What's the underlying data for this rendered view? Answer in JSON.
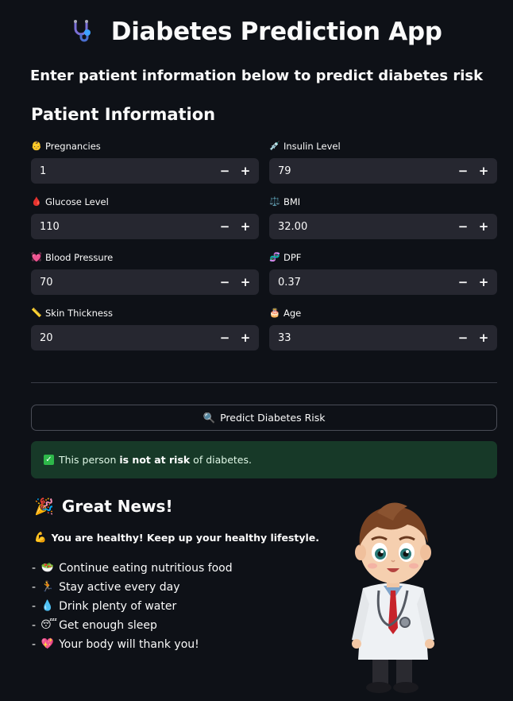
{
  "header": {
    "title_icon": "stethoscope-icon",
    "title": "Diabetes Prediction App",
    "subtitle": "Enter patient information below to predict diabetes risk"
  },
  "form": {
    "section_title": "Patient Information",
    "fields": [
      {
        "label": "Pregnancies",
        "icon": "baby-icon",
        "value": "1"
      },
      {
        "label": "Insulin Level",
        "icon": "syringe-icon",
        "value": "79"
      },
      {
        "label": "Glucose Level",
        "icon": "blood-drop-icon",
        "value": "110"
      },
      {
        "label": "BMI",
        "icon": "scale-icon",
        "value": "32.00"
      },
      {
        "label": "Blood Pressure",
        "icon": "heart-icon",
        "value": "70"
      },
      {
        "label": "DPF",
        "icon": "dna-icon",
        "value": "0.37"
      },
      {
        "label": "Skin Thickness",
        "icon": "ruler-icon",
        "value": "20"
      },
      {
        "label": "Age",
        "icon": "cake-icon",
        "value": "33"
      }
    ],
    "minus_label": "−",
    "plus_label": "+"
  },
  "predict_button": {
    "icon": "magnifier-icon",
    "label": "Predict Diabetes Risk"
  },
  "result": {
    "icon": "check-icon",
    "prefix": "This person ",
    "bold": "is not at risk",
    "suffix": " of diabetes.",
    "bg_color": "#173928"
  },
  "news": {
    "icon": "party-popper-icon",
    "title": "Great News!",
    "healthy_icon": "flexed-biceps-icon",
    "healthy_text": "You are healthy! Keep up your healthy lifestyle.",
    "tips": [
      {
        "icon": "salad-icon",
        "text": "Continue eating nutritious food"
      },
      {
        "icon": "running-person-icon",
        "text": "Stay active every day"
      },
      {
        "icon": "water-drop-icon",
        "text": "Drink plenty of water"
      },
      {
        "icon": "sleeping-face-icon",
        "text": "Get enough sleep"
      },
      {
        "icon": "sparkling-heart-icon",
        "text": "Your body will thank you!"
      }
    ]
  },
  "illustration": {
    "icon": "cartoon-doctor-icon"
  }
}
